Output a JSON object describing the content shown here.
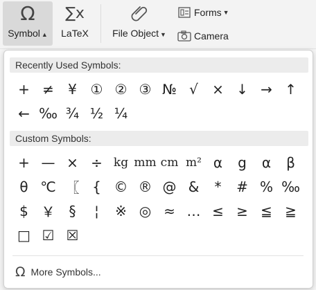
{
  "ribbon": {
    "symbol": {
      "label": "Symbol",
      "icon": "Ω"
    },
    "latex": {
      "label": "LaTeX",
      "icon": "∑x"
    },
    "file_object": {
      "label": "File Object"
    },
    "forms": {
      "label": "Forms"
    },
    "camera": {
      "label": "Camera"
    }
  },
  "panel": {
    "recent_title": "Recently Used Symbols:",
    "recent_symbols": [
      "+",
      "≠",
      "¥",
      "①",
      "②",
      "③",
      "№",
      "√",
      "×",
      "↓",
      "→",
      "↑",
      "←",
      "‰",
      "¾",
      "½",
      "¼"
    ],
    "custom_title": "Custom Symbols:",
    "custom_symbols": [
      "+",
      "—",
      "×",
      "÷",
      "kg",
      "mm",
      "cm",
      "m²",
      "α",
      "g",
      "α",
      "β",
      "θ",
      "℃",
      "〖",
      "{",
      "©",
      "®",
      "@",
      "&",
      "*",
      "#",
      "%",
      "‰",
      "$",
      "￥",
      "§",
      "¦",
      "※",
      "◎",
      "≈",
      "…",
      "≤",
      "≥",
      "≦",
      "≧",
      "□",
      "☑",
      "☒"
    ],
    "more_label": "More Symbols...",
    "more_icon": "Ω"
  }
}
